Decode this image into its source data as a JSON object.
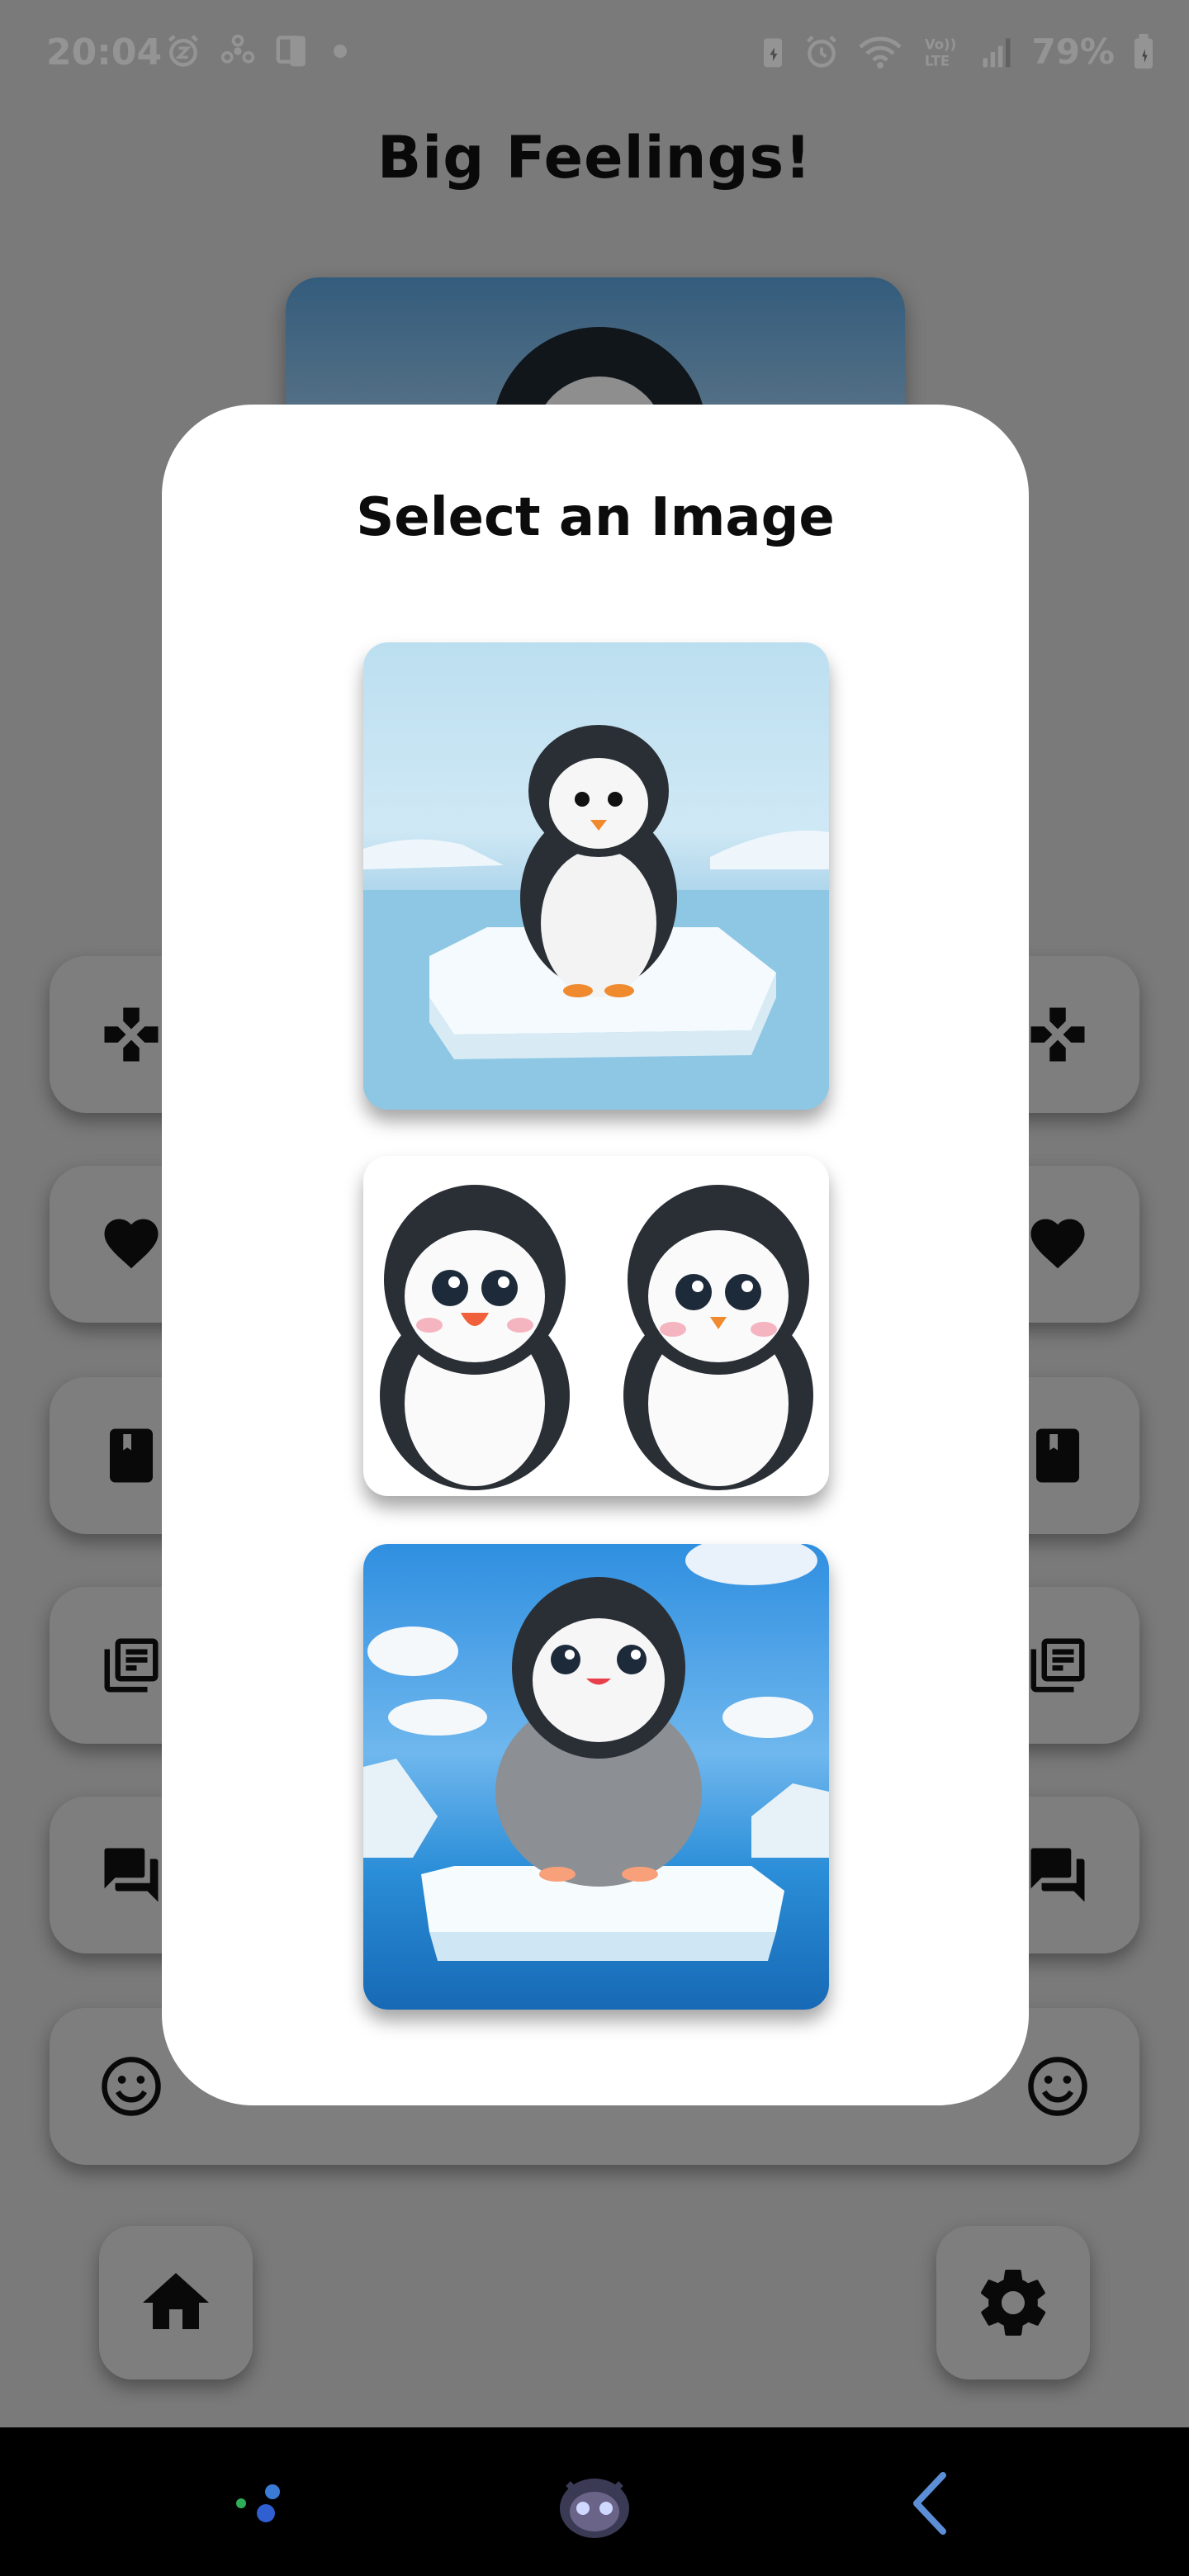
{
  "status_bar": {
    "time": "20:04",
    "battery": "79%",
    "left_icons": [
      "alarm-snooze-icon",
      "fan-icon",
      "screen-mirror-icon",
      "dot-icon"
    ],
    "right_icons": [
      "battery-saver-icon",
      "alarm-icon",
      "wifi-icon",
      "volte-icon",
      "signal-icon",
      "battery-icon"
    ],
    "volte_label": "Vo)) LTE"
  },
  "app": {
    "title": "Big Feelings!",
    "side_buttons": [
      {
        "left_icon": "gamepad-icon",
        "right_icon": "gamepad-icon"
      },
      {
        "left_icon": "heart-icon",
        "right_icon": "heart-icon"
      },
      {
        "left_icon": "book-icon",
        "right_icon": "book-icon"
      },
      {
        "left_icon": "library-icon",
        "right_icon": "library-icon"
      },
      {
        "left_icon": "chat-icon",
        "right_icon": "chat-icon"
      }
    ],
    "bottom_row": {
      "left_icon": "smiley-icon",
      "right_icon": "smiley-icon"
    },
    "home_icon": "home-icon",
    "settings_icon": "gear-icon"
  },
  "dialog": {
    "title": "Select an Image",
    "options": [
      {
        "subject": "penguin on ice floe",
        "icon": "penguin-image"
      },
      {
        "subject": "two penguins",
        "icon": "penguin-pair-image"
      },
      {
        "subject": "penguin with clouds",
        "icon": "penguin-sky-image"
      }
    ]
  },
  "nav_bar": {
    "items": [
      "recents-icon",
      "home-assistant-icon",
      "back-icon"
    ]
  },
  "colors": {
    "scrim": "#000000",
    "dialog_bg": "#ffffff",
    "button_bg": "#d9d9d9",
    "nav_bg": "#000000"
  }
}
